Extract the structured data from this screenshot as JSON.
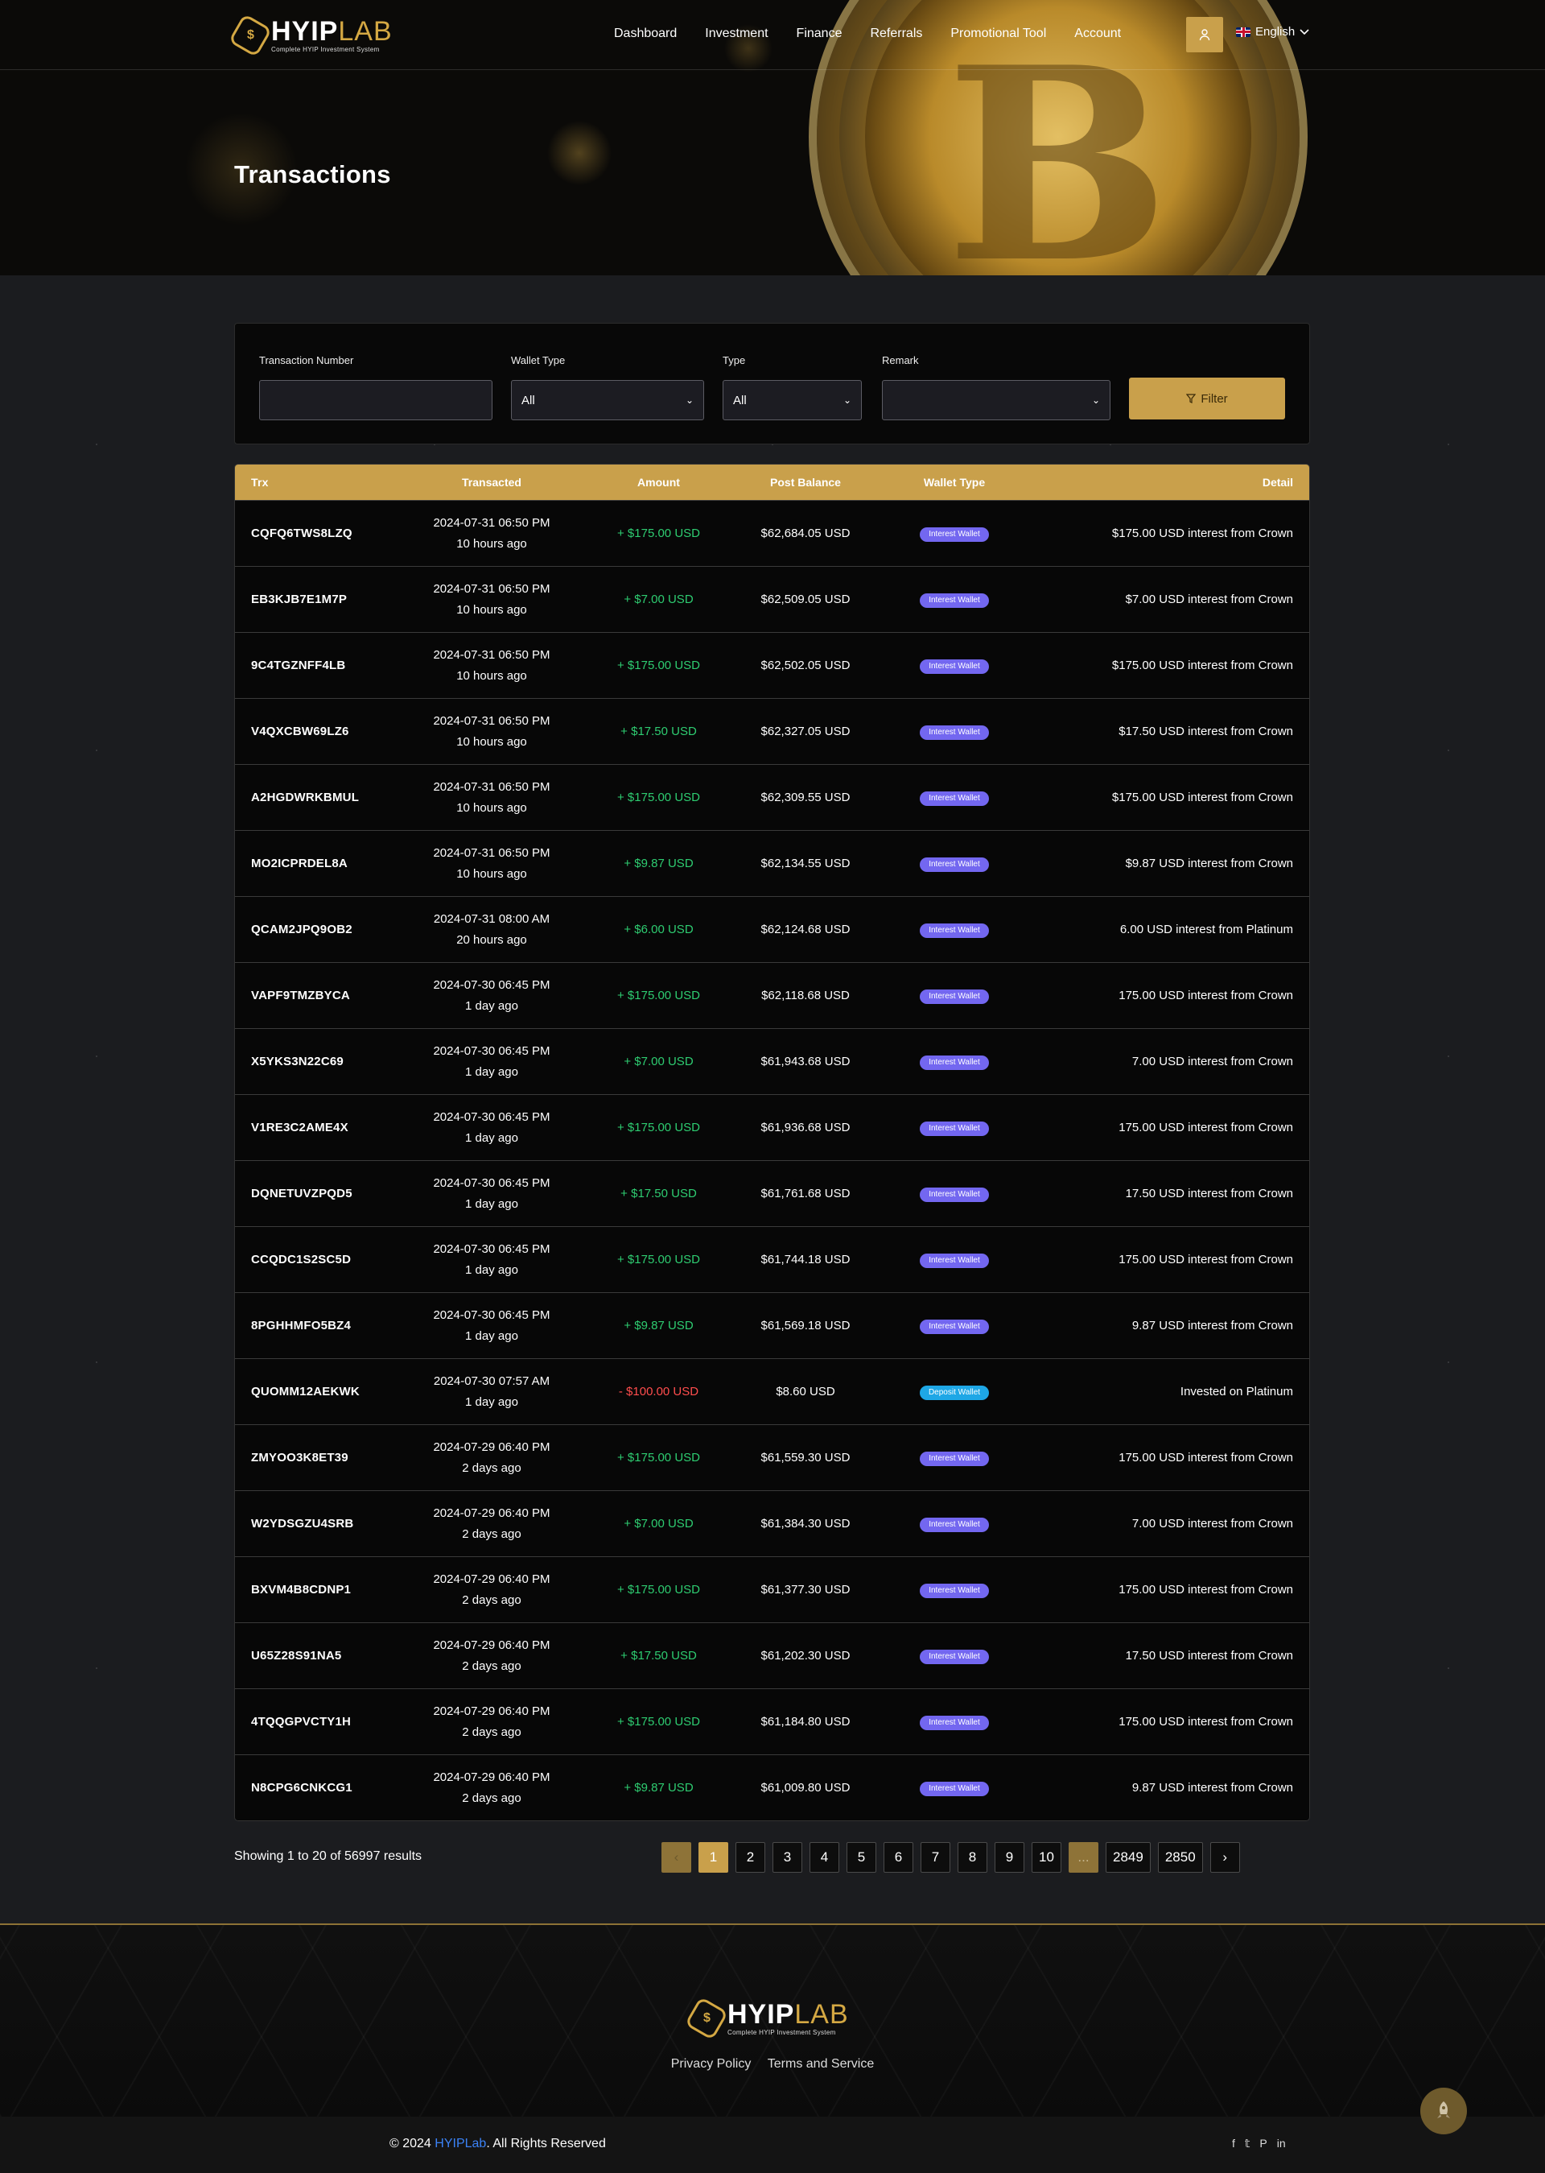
{
  "brand": {
    "logo_word_1": "HYIP",
    "logo_word_2": "LAB",
    "tagline": "Complete HYIP Investment System"
  },
  "nav": {
    "links": [
      "Dashboard",
      "Investment",
      "Finance",
      "Referrals",
      "Promotional Tool",
      "Account"
    ],
    "language": "English",
    "user_icon": "user-icon"
  },
  "page_title": "Transactions",
  "filter": {
    "trx_label": "Transaction Number",
    "trx_value": "",
    "wallet_label": "Wallet Type",
    "wallet_value": "All",
    "type_label": "Type",
    "type_value": "All",
    "remark_label": "Remark",
    "remark_value": "",
    "button_label": "Filter"
  },
  "table": {
    "headers": [
      "Trx",
      "Transacted",
      "Amount",
      "Post Balance",
      "Wallet Type",
      "Detail"
    ],
    "rows": [
      {
        "trx": "CQFQ6TWS8LZQ",
        "date": "2024-07-31 06:50 PM",
        "ago": "10 hours ago",
        "amount": "+ $175.00 USD",
        "balance": "$62,684.05 USD",
        "wallet": "Interest Wallet",
        "detail": "$175.00 USD interest from Crown"
      },
      {
        "trx": "EB3KJB7E1M7P",
        "date": "2024-07-31 06:50 PM",
        "ago": "10 hours ago",
        "amount": "+ $7.00 USD",
        "balance": "$62,509.05 USD",
        "wallet": "Interest Wallet",
        "detail": "$7.00 USD interest from Crown"
      },
      {
        "trx": "9C4TGZNFF4LB",
        "date": "2024-07-31 06:50 PM",
        "ago": "10 hours ago",
        "amount": "+ $175.00 USD",
        "balance": "$62,502.05 USD",
        "wallet": "Interest Wallet",
        "detail": "$175.00 USD interest from Crown"
      },
      {
        "trx": "V4QXCBW69LZ6",
        "date": "2024-07-31 06:50 PM",
        "ago": "10 hours ago",
        "amount": "+ $17.50 USD",
        "balance": "$62,327.05 USD",
        "wallet": "Interest Wallet",
        "detail": "$17.50 USD interest from Crown"
      },
      {
        "trx": "A2HGDWRKBMUL",
        "date": "2024-07-31 06:50 PM",
        "ago": "10 hours ago",
        "amount": "+ $175.00 USD",
        "balance": "$62,309.55 USD",
        "wallet": "Interest Wallet",
        "detail": "$175.00 USD interest from Crown"
      },
      {
        "trx": "MO2ICPRDEL8A",
        "date": "2024-07-31 06:50 PM",
        "ago": "10 hours ago",
        "amount": "+ $9.87 USD",
        "balance": "$62,134.55 USD",
        "wallet": "Interest Wallet",
        "detail": "$9.87 USD interest from Crown"
      },
      {
        "trx": "QCAM2JPQ9OB2",
        "date": "2024-07-31 08:00 AM",
        "ago": "20 hours ago",
        "amount": "+ $6.00 USD",
        "balance": "$62,124.68 USD",
        "wallet": "Interest Wallet",
        "detail": "6.00 USD interest from Platinum"
      },
      {
        "trx": "VAPF9TMZBYCA",
        "date": "2024-07-30 06:45 PM",
        "ago": "1 day ago",
        "amount": "+ $175.00 USD",
        "balance": "$62,118.68 USD",
        "wallet": "Interest Wallet",
        "detail": "175.00 USD interest from Crown"
      },
      {
        "trx": "X5YKS3N22C69",
        "date": "2024-07-30 06:45 PM",
        "ago": "1 day ago",
        "amount": "+ $7.00 USD",
        "balance": "$61,943.68 USD",
        "wallet": "Interest Wallet",
        "detail": "7.00 USD interest from Crown"
      },
      {
        "trx": "V1RE3C2AME4X",
        "date": "2024-07-30 06:45 PM",
        "ago": "1 day ago",
        "amount": "+ $175.00 USD",
        "balance": "$61,936.68 USD",
        "wallet": "Interest Wallet",
        "detail": "175.00 USD interest from Crown"
      },
      {
        "trx": "DQNETUVZPQD5",
        "date": "2024-07-30 06:45 PM",
        "ago": "1 day ago",
        "amount": "+ $17.50 USD",
        "balance": "$61,761.68 USD",
        "wallet": "Interest Wallet",
        "detail": "17.50 USD interest from Crown"
      },
      {
        "trx": "CCQDC1S2SC5D",
        "date": "2024-07-30 06:45 PM",
        "ago": "1 day ago",
        "amount": "+ $175.00 USD",
        "balance": "$61,744.18 USD",
        "wallet": "Interest Wallet",
        "detail": "175.00 USD interest from Crown"
      },
      {
        "trx": "8PGHHMFO5BZ4",
        "date": "2024-07-30 06:45 PM",
        "ago": "1 day ago",
        "amount": "+ $9.87 USD",
        "balance": "$61,569.18 USD",
        "wallet": "Interest Wallet",
        "detail": "9.87 USD interest from Crown"
      },
      {
        "trx": "QUOMM12AEKWK",
        "date": "2024-07-30 07:57 AM",
        "ago": "1 day ago",
        "amount": "- $100.00 USD",
        "balance": "$8.60 USD",
        "wallet": "Deposit Wallet",
        "detail": "Invested on Platinum"
      },
      {
        "trx": "ZMYOO3K8ET39",
        "date": "2024-07-29 06:40 PM",
        "ago": "2 days ago",
        "amount": "+ $175.00 USD",
        "balance": "$61,559.30 USD",
        "wallet": "Interest Wallet",
        "detail": "175.00 USD interest from Crown"
      },
      {
        "trx": "W2YDSGZU4SRB",
        "date": "2024-07-29 06:40 PM",
        "ago": "2 days ago",
        "amount": "+ $7.00 USD",
        "balance": "$61,384.30 USD",
        "wallet": "Interest Wallet",
        "detail": "7.00 USD interest from Crown"
      },
      {
        "trx": "BXVM4B8CDNP1",
        "date": "2024-07-29 06:40 PM",
        "ago": "2 days ago",
        "amount": "+ $175.00 USD",
        "balance": "$61,377.30 USD",
        "wallet": "Interest Wallet",
        "detail": "175.00 USD interest from Crown"
      },
      {
        "trx": "U65Z28S91NA5",
        "date": "2024-07-29 06:40 PM",
        "ago": "2 days ago",
        "amount": "+ $17.50 USD",
        "balance": "$61,202.30 USD",
        "wallet": "Interest Wallet",
        "detail": "17.50 USD interest from Crown"
      },
      {
        "trx": "4TQQGPVCTY1H",
        "date": "2024-07-29 06:40 PM",
        "ago": "2 days ago",
        "amount": "+ $175.00 USD",
        "balance": "$61,184.80 USD",
        "wallet": "Interest Wallet",
        "detail": "175.00 USD interest from Crown"
      },
      {
        "trx": "N8CPG6CNKCG1",
        "date": "2024-07-29 06:40 PM",
        "ago": "2 days ago",
        "amount": "+ $9.87 USD",
        "balance": "$61,009.80 USD",
        "wallet": "Interest Wallet",
        "detail": "9.87 USD interest from Crown"
      }
    ]
  },
  "pagination": {
    "summary": "Showing 1 to 20 of 56997 results",
    "prev": "‹",
    "pages": [
      "1",
      "2",
      "3",
      "4",
      "5",
      "6",
      "7",
      "8",
      "9",
      "10",
      "...",
      "2849",
      "2850"
    ],
    "next": "›",
    "current": "1"
  },
  "footer": {
    "links": [
      "Privacy Policy",
      "Terms and Service"
    ],
    "copyright_prefix": "© 2024 ",
    "copyright_brand": "HYIPLab",
    "copyright_suffix": ". All Rights Reserved",
    "socials": [
      "facebook-icon",
      "twitter-icon",
      "pinterest-icon",
      "linkedin-icon"
    ]
  },
  "colors": {
    "accent": "#c9a04b",
    "positive": "#2ecc71",
    "negative": "#ff4d4d",
    "interest_badge": "#7367f0",
    "deposit_badge": "#1ea7e6",
    "brand_link": "#3b82f6"
  }
}
